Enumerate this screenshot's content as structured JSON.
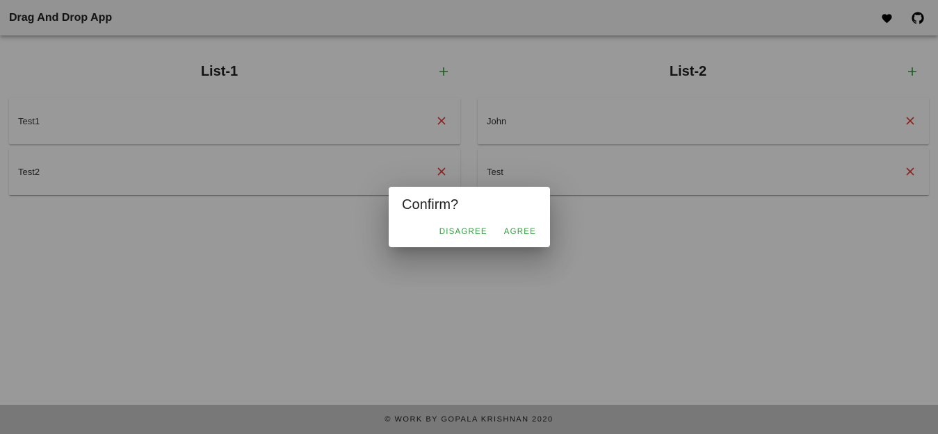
{
  "app": {
    "title": "Drag And Drop App",
    "icons": [
      "heart-icon",
      "github-icon"
    ]
  },
  "colors": {
    "accent_green": "#2e9d3b",
    "delete_red": "#e53935"
  },
  "lists": [
    {
      "title": "List-1",
      "items": [
        "Test1",
        "Test2"
      ]
    },
    {
      "title": "List-2",
      "items": [
        "John",
        "Test"
      ]
    }
  ],
  "dialog": {
    "title": "Confirm?",
    "disagree_label": "DISAGREE",
    "agree_label": "AGREE"
  },
  "footer": {
    "text": "© WORK BY GOPALA KRISHNAN 2020"
  }
}
